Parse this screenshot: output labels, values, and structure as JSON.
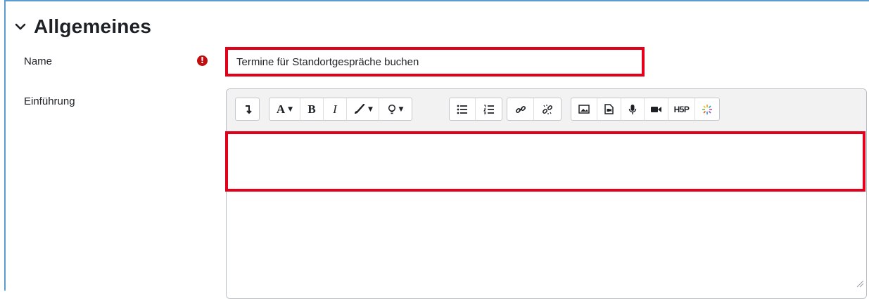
{
  "section": {
    "title": "Allgemeines",
    "expanded_icon": "chevron-down-icon"
  },
  "fields": {
    "name": {
      "label": "Name",
      "value": "Termine für Standortgespräche buchen",
      "required_icon": "exclamation-circle-icon"
    },
    "intro": {
      "label": "Einführung"
    }
  },
  "toolbar": {
    "groups": [
      {
        "buttons": [
          {
            "icon": "collapse-toolbar-icon"
          }
        ]
      },
      {
        "buttons": [
          {
            "label": "A",
            "icon": "font-size-dropdown"
          },
          {
            "label": "B",
            "icon": "bold"
          },
          {
            "label": "I",
            "icon": "italic"
          },
          {
            "icon": "text-color-dropdown-icon"
          },
          {
            "icon": "styles-lightbulb-dropdown-icon"
          }
        ]
      },
      {
        "buttons": [
          {
            "icon": "unordered-list-icon"
          },
          {
            "icon": "ordered-list-icon"
          }
        ]
      },
      {
        "buttons": [
          {
            "icon": "link-icon"
          },
          {
            "icon": "unlink-icon"
          }
        ]
      },
      {
        "buttons": [
          {
            "icon": "image-icon"
          },
          {
            "icon": "media-icon"
          },
          {
            "icon": "record-audio-icon"
          },
          {
            "icon": "record-video-icon"
          },
          {
            "label": "H5P",
            "icon": "h5p-icon"
          },
          {
            "icon": "sparkle-icon"
          }
        ]
      }
    ]
  },
  "colors": {
    "highlight": "#e2001a",
    "required": "#c00d0d",
    "frame": "#5c9ccf",
    "toolbar_bg": "#f2f2f2"
  }
}
